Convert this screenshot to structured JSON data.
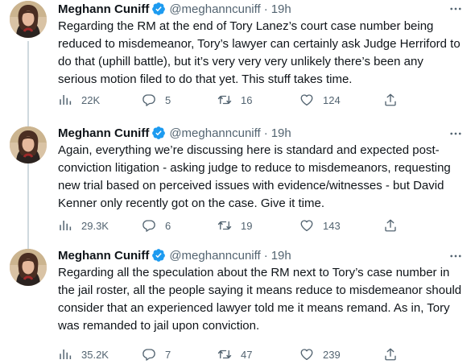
{
  "colors": {
    "text_primary": "#0f1419",
    "text_secondary": "#536471",
    "verified_blue": "#1d9bf0",
    "thread_line": "#cfd9de"
  },
  "tweets": [
    {
      "author_name": "Meghann Cuniff",
      "handle": "@meghanncuniff",
      "separator": "·",
      "time": "19h",
      "text": "Regarding the RM at the end of Tory Lanez’s court case number being\nreduced to misdemeanor, Tory’s lawyer can certainly ask Judge Herriford to\ndo that (uphill battle), but it’s very very very unlikely there’s been any\nserious motion filed to do that yet. This stuff takes time.",
      "views": "22K",
      "replies": "5",
      "retweets": "16",
      "likes": "124"
    },
    {
      "author_name": "Meghann Cuniff",
      "handle": "@meghanncuniff",
      "separator": "·",
      "time": "19h",
      "text": "Again, everything we’re discussing here is standard and expected post-\nconviction litigation - asking judge to reduce to misdemeanors, requesting\nnew trial based on perceived issues with evidence/witnesses - but David\nKenner only recently got on the case. Give it time.",
      "views": "29.3K",
      "replies": "6",
      "retweets": "19",
      "likes": "143"
    },
    {
      "author_name": "Meghann Cuniff",
      "handle": "@meghanncuniff",
      "separator": "·",
      "time": "19h",
      "text": "Regarding all the speculation about the RM next to Tory’s case number in\nthe jail roster, all the people saying it means reduce to misdemeanor should\nconsider that an experienced lawyer told me it means remand. As in, Tory\nwas remanded to jail upon conviction.",
      "views": "35.2K",
      "replies": "7",
      "retweets": "47",
      "likes": "239"
    }
  ],
  "icons": {
    "verified": "verified-badge-icon",
    "more": "more-horizontal-icon",
    "views": "analytics-icon",
    "reply": "reply-icon",
    "retweet": "retweet-icon",
    "like": "heart-icon",
    "share": "share-icon"
  }
}
